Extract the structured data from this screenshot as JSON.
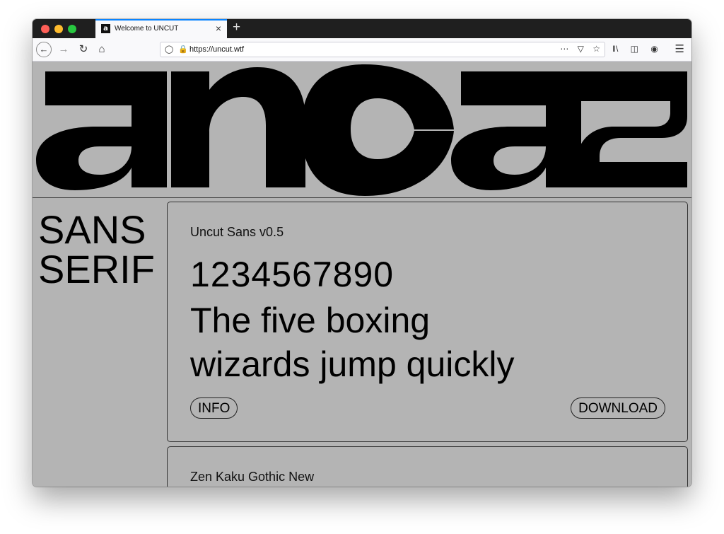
{
  "browser": {
    "tab_title": "Welcome to UNCUT",
    "tab_favicon": "a",
    "tab_close": "×",
    "new_tab": "+",
    "url": "https://uncut.wtf",
    "icons": [
      "back-icon",
      "forward-icon",
      "reload-icon",
      "home-icon",
      "shield-icon",
      "lock-icon",
      "more-icon",
      "pocket-icon",
      "bookmark-star-icon",
      "library-icon",
      "sidebar-icon",
      "account-icon",
      "menu-icon"
    ]
  },
  "page": {
    "logo_text": "uncut",
    "category": {
      "line1": "SANS",
      "line2": "SERIF"
    },
    "cards": [
      {
        "font_name": "Uncut Sans v0.5",
        "sample_numbers": "1234567890",
        "sample_text_line1": "The five boxing",
        "sample_text_line2": "wizards jump quickly",
        "info_label": "INFO",
        "download_label": "DOWNLOAD"
      },
      {
        "font_name": "Zen Kaku Gothic New"
      }
    ]
  },
  "colors": {
    "page_bg": "#b4b4b4",
    "text": "#000000",
    "accent_tab": "#0a84ff"
  }
}
